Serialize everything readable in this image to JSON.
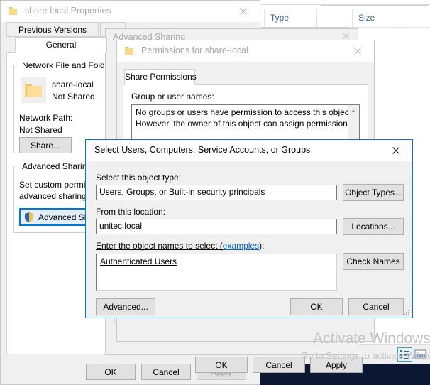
{
  "explorer": {
    "columns": [
      "Type",
      "Size"
    ],
    "view_details_icon": "details-view-icon",
    "view_tiles_icon": "tiles-view-icon"
  },
  "properties_window": {
    "title": "share-local Properties",
    "icon": "folder-icon",
    "close_icon": "close-icon",
    "tabs": [
      {
        "label": "Previous Versions",
        "selected": false
      },
      {
        "label": "General",
        "selected": true
      }
    ],
    "network_share_group": {
      "title": "Network File and Folder Sharing",
      "folder_icon": "folder-icon",
      "share_name": "share-local",
      "share_status": "Not Shared",
      "network_path_label": "Network Path:",
      "network_path_value": "Not Shared",
      "share_button": "Share..."
    },
    "advanced_sharing_group": {
      "title": "Advanced Sharing",
      "description_line1": "Set custom permissions, create multiple shares, and set other",
      "description_line2": "advanced sharing options.",
      "button_label": "Advanced Sharing...",
      "button_icon": "shield-icon"
    },
    "buttons": {
      "ok": "OK",
      "cancel": "Cancel",
      "apply": "Apply",
      "apply_disabled": true
    }
  },
  "advanced_sharing_window": {
    "title": "Advanced Sharing",
    "close_icon": "close-icon",
    "buttons": {
      "ok": "OK",
      "cancel": "Cancel",
      "apply": "Apply"
    }
  },
  "permissions_window": {
    "title": "Permissions for share-local",
    "icon": "folder-icon",
    "close_icon": "close-icon",
    "tabs": [
      {
        "label": "Share Permissions",
        "selected": true
      }
    ],
    "group_label": "Group or user names:",
    "message_line1": "No groups or users have permission to access this object.",
    "message_line2": "However, the owner of this object can assign permissions.",
    "scroll_up_icon": "scroll-up-icon"
  },
  "select_users_dialog": {
    "title": "Select Users, Computers, Service Accounts, or Groups",
    "close_icon": "close-icon",
    "object_type_label": "Select this object type:",
    "object_type_value": "Users, Groups, or Built-in security principals",
    "object_types_button": "Object Types...",
    "location_label": "From this location:",
    "location_value": "unitec.local",
    "locations_button": "Locations...",
    "names_label_prefix": "Enter the object names to select (",
    "names_label_link": "examples",
    "names_label_suffix": "):",
    "names_value": "Authenticated Users",
    "check_names_button": "Check Names",
    "advanced_button": "Advanced...",
    "ok_button": "OK",
    "cancel_button": "Cancel",
    "resize_grip_icon": "resize-grip-icon"
  },
  "activate_watermark": {
    "title": "Activate Windows",
    "subtitle": "Go to Settings to activate Windows."
  },
  "colors": {
    "accent": "#0078d7",
    "dialog_bg": "#f0f0f0",
    "desktop": "#0b1733",
    "link": "#0066cc",
    "column_header": "#41618a"
  }
}
